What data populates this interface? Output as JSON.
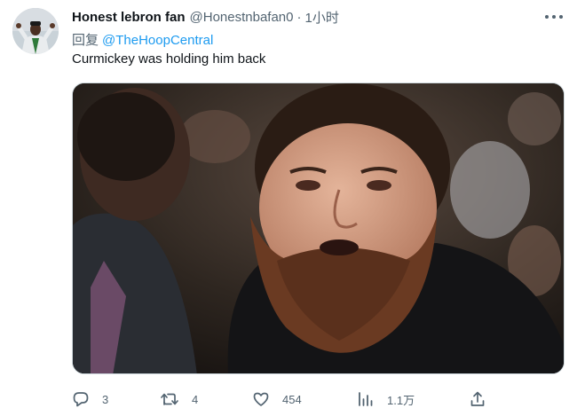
{
  "tweet": {
    "display_name": "Honest lebron fan",
    "handle": "@Honestnbafan0",
    "separator": "·",
    "time": "1小时",
    "reply_prefix": "回复",
    "reply_to": "@TheHoopCentral",
    "text": "Curmickey was holding him back"
  },
  "actions": {
    "reply_count": "3",
    "retweet_count": "4",
    "like_count": "454",
    "views_count": "1.1万"
  },
  "icons": {
    "more": "more-icon",
    "reply": "reply-icon",
    "retweet": "retweet-icon",
    "like": "like-icon",
    "views": "views-icon",
    "share": "share-icon"
  },
  "colors": {
    "text": "#0f1419",
    "secondary": "#536471",
    "link": "#1d9bf0",
    "border": "#cfd9de"
  }
}
